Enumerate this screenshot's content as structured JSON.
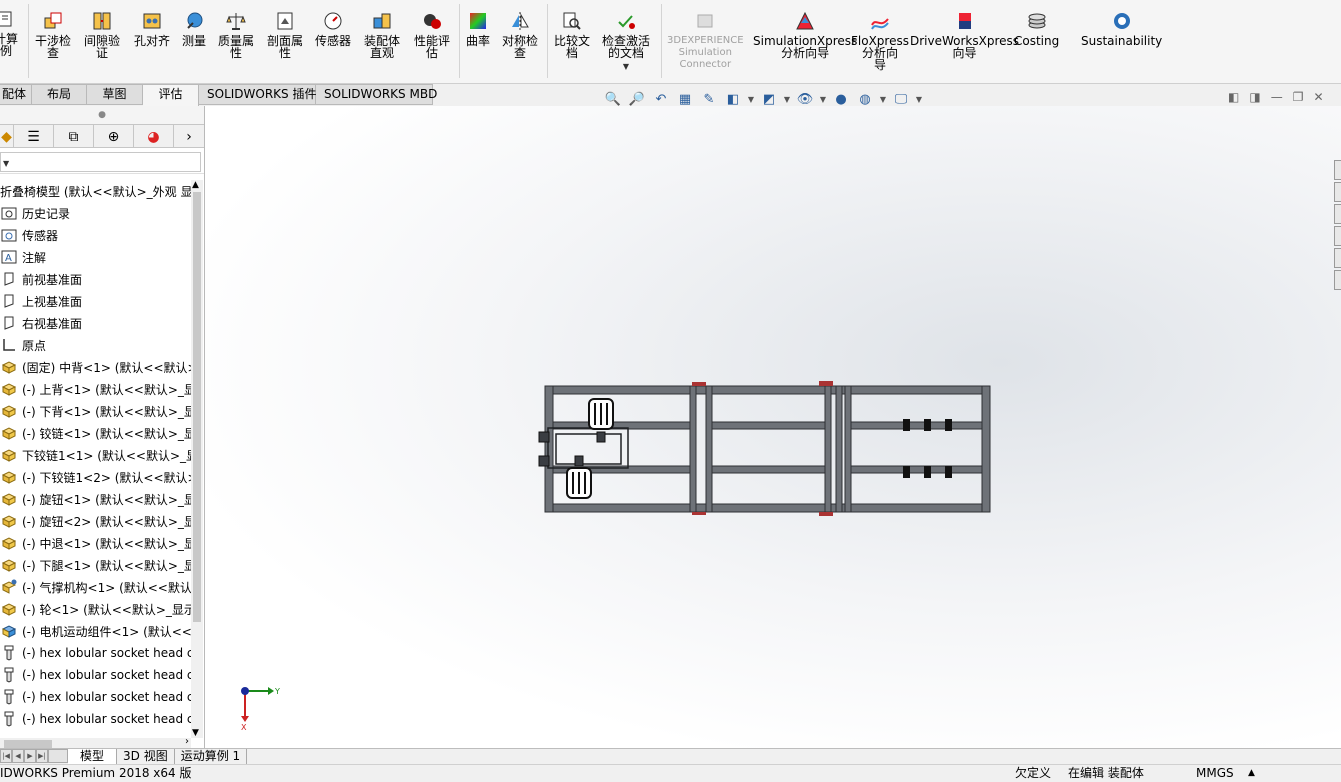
{
  "ribbon": {
    "buttons": [
      {
        "label": "计算\n例",
        "name": "calc-button"
      },
      {
        "label": "干涉检\n查",
        "name": "interference-check-button"
      },
      {
        "label": "间隙验\n证",
        "name": "clearance-verify-button"
      },
      {
        "label": "孔对齐",
        "name": "hole-align-button"
      },
      {
        "label": "测量",
        "name": "measure-button"
      },
      {
        "label": "质量属\n性",
        "name": "mass-properties-button"
      },
      {
        "label": "剖面属\n性",
        "name": "section-properties-button"
      },
      {
        "label": "传感器",
        "name": "sensor-button"
      },
      {
        "label": "装配体\n直观",
        "name": "assembly-visualization-button"
      },
      {
        "label": "性能评\n估",
        "name": "performance-eval-button"
      },
      {
        "label": "曲率",
        "name": "curvature-button"
      },
      {
        "label": "对称检\n查",
        "name": "symmetry-check-button"
      },
      {
        "label": "比较文\n档",
        "name": "compare-documents-button"
      },
      {
        "label": "检查激活\n的文档",
        "name": "check-active-doc-button"
      },
      {
        "label": "3DEXPERIENCE\nSimulation\nConnector",
        "name": "3dexperience-connector-button"
      },
      {
        "label": "SimulationXpress\n分析向导",
        "name": "simulationxpress-button"
      },
      {
        "label": "FloXpress\n分析向\n导",
        "name": "floxpress-button"
      },
      {
        "label": "DriveWorksXpress\n向导",
        "name": "driveworksxpress-button"
      },
      {
        "label": "Costing",
        "name": "costing-button"
      },
      {
        "label": "Sustainability",
        "name": "sustainability-button"
      }
    ]
  },
  "tabs": [
    "配体",
    "布局",
    "草图",
    "评估",
    "SOLIDWORKS 插件",
    "SOLIDWORKS MBD"
  ],
  "feature_tree": {
    "root": "折叠椅模型 (默认<<默认>_外观 显",
    "items": [
      {
        "label": "历史记录",
        "icon": "history-icon"
      },
      {
        "label": "传感器",
        "icon": "sensor-icon"
      },
      {
        "label": "注解",
        "icon": "annotation-icon"
      },
      {
        "label": "前视基准面",
        "icon": "plane-icon"
      },
      {
        "label": "上视基准面",
        "icon": "plane-icon"
      },
      {
        "label": "右视基准面",
        "icon": "plane-icon"
      },
      {
        "label": "原点",
        "icon": "origin-icon"
      },
      {
        "label": "(固定) 中背<1> (默认<<默认>",
        "icon": "part-icon"
      },
      {
        "label": "(-) 上背<1> (默认<<默认>_显",
        "icon": "part-icon"
      },
      {
        "label": "(-) 下背<1> (默认<<默认>_显",
        "icon": "part-icon"
      },
      {
        "label": "(-) 铰链<1> (默认<<默认>_显",
        "icon": "part-icon"
      },
      {
        "label": "下铰链1<1> (默认<<默认>_显",
        "icon": "part-icon"
      },
      {
        "label": "(-) 下铰链1<2> (默认<<默认>",
        "icon": "part-icon"
      },
      {
        "label": "(-) 旋钮<1> (默认<<默认>_显",
        "icon": "part-icon"
      },
      {
        "label": "(-) 旋钮<2> (默认<<默认>_显",
        "icon": "part-icon"
      },
      {
        "label": "(-) 中退<1> (默认<<默认>_显",
        "icon": "part-icon"
      },
      {
        "label": "(-) 下腿<1> (默认<<默认>_显",
        "icon": "part-icon"
      },
      {
        "label": "(-) 气撑机构<1> (默认<<默认",
        "icon": "subassembly-icon"
      },
      {
        "label": "(-) 轮<1> (默认<<默认>_显示",
        "icon": "part-icon"
      },
      {
        "label": "(-) 电机运动组件<1> (默认<<",
        "icon": "assembly-icon"
      },
      {
        "label": "(-) hex lobular socket head c",
        "icon": "screw-icon"
      },
      {
        "label": "(-) hex lobular socket head c",
        "icon": "screw-icon"
      },
      {
        "label": "(-) hex lobular socket head c",
        "icon": "screw-icon"
      },
      {
        "label": "(-) hex lobular socket head c",
        "icon": "screw-icon"
      }
    ]
  },
  "bottom_tabs": [
    "模型",
    "3D 视图",
    "运动算例 1"
  ],
  "status": {
    "product": "IDWORKS Premium 2018 x64 版",
    "under_defined": "欠定义",
    "editing": "在编辑 装配体",
    "units": "MMGS"
  },
  "triad": {
    "y_label": "Y",
    "x_label": "X"
  }
}
